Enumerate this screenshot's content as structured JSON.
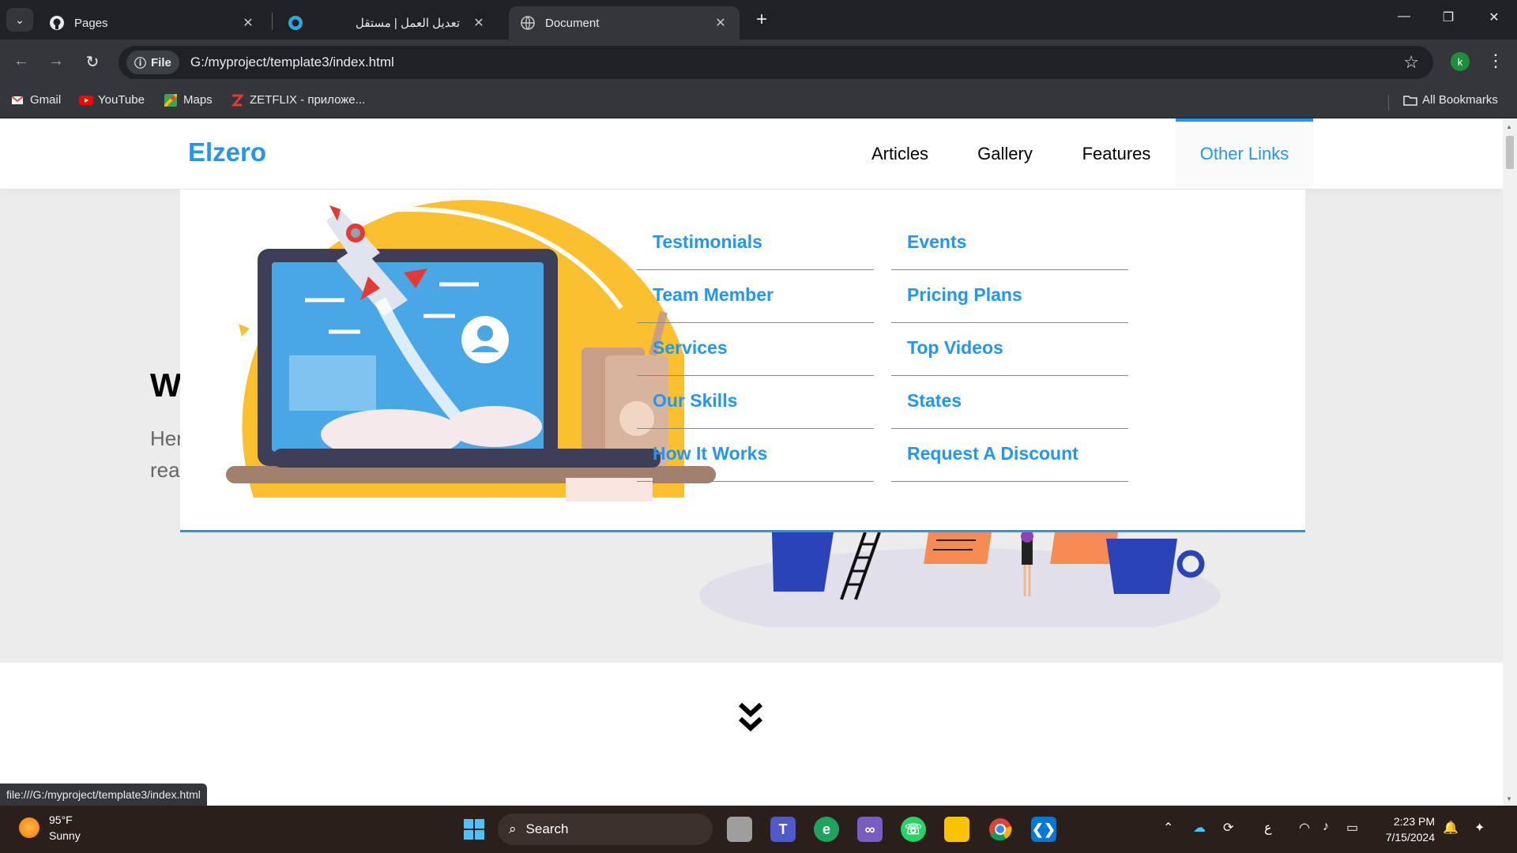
{
  "browser": {
    "tabs": [
      {
        "title": "Pages",
        "icon": "github-icon",
        "active": false
      },
      {
        "title": "تعديل العمل | مستقل",
        "icon": "mostaql-icon",
        "active": false
      },
      {
        "title": "Document",
        "icon": "globe-icon",
        "active": true
      }
    ],
    "address": {
      "scheme_label": "File",
      "url": "G:/myproject/template3/index.html"
    },
    "profile_initial": "k",
    "bookmarks": [
      {
        "label": "Gmail",
        "icon": "gmail-icon"
      },
      {
        "label": "YouTube",
        "icon": "youtube-icon"
      },
      {
        "label": "Maps",
        "icon": "maps-icon"
      },
      {
        "label": "ZETFLIX - приложе...",
        "icon": "zetflix-icon"
      }
    ],
    "all_bookmarks_label": "All Bookmarks",
    "status_url": "file:///G:/myproject/template3/index.html"
  },
  "site": {
    "logo": "Elzero",
    "nav": [
      {
        "label": "Articles",
        "active": false
      },
      {
        "label": "Gallery",
        "active": false
      },
      {
        "label": "Features",
        "active": false
      },
      {
        "label": "Other Links",
        "active": true
      }
    ],
    "landing": {
      "title_partial": "W",
      "text_line1": "Her",
      "text_line2": "rea"
    },
    "mega_menu": {
      "column1": [
        "Testimonials",
        "Team Member",
        "Services",
        "Our Skills",
        "How It Works"
      ],
      "column2": [
        "Events",
        "Pricing Plans",
        "Top Videos",
        "States",
        "Request A Discount"
      ]
    },
    "colors": {
      "accent": "#2196f3",
      "landing_bg": "#ececec"
    }
  },
  "taskbar": {
    "weather": {
      "temp": "95°F",
      "condition": "Sunny"
    },
    "search_label": "Search",
    "time": "2:23 PM",
    "date": "7/15/2024",
    "language": "ع"
  }
}
